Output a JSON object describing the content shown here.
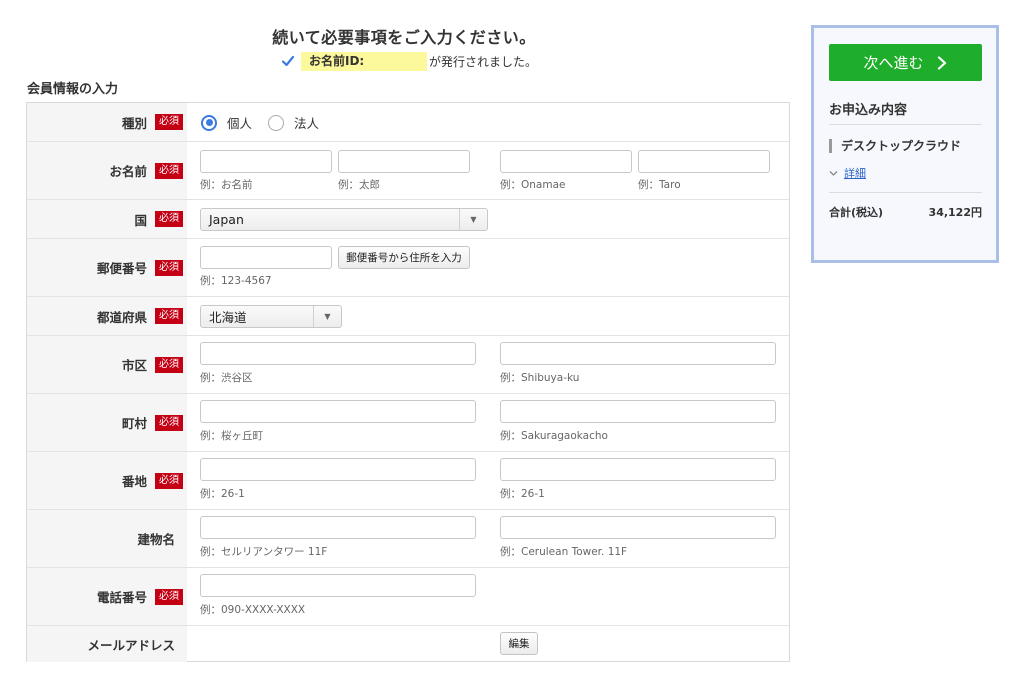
{
  "header": {
    "title": "続いて必要事項をご入力ください。",
    "id_label": "お名前ID:",
    "id_suffix": "が発行されました。"
  },
  "section_title": "会員情報の入力",
  "required_badge": "必須",
  "form": {
    "type": {
      "label": "種別",
      "options": [
        "個人",
        "法人"
      ],
      "selected": "個人"
    },
    "name": {
      "label": "お名前",
      "hints": [
        "例：お名前",
        "例：太郎",
        "例：Onamae",
        "例：Taro"
      ]
    },
    "country": {
      "label": "国",
      "value": "Japan"
    },
    "postal": {
      "label": "郵便番号",
      "button": "郵便番号から住所を入力",
      "hint": "例：123-4567"
    },
    "prefecture": {
      "label": "都道府県",
      "value": "北海道"
    },
    "city": {
      "label": "市区",
      "hints": [
        "例：渋谷区",
        "例：Shibuya-ku"
      ]
    },
    "town": {
      "label": "町村",
      "hints": [
        "例：桜ヶ丘町",
        "例：Sakuragaokacho"
      ]
    },
    "block": {
      "label": "番地",
      "hints": [
        "例：26-1",
        "例：26-1"
      ]
    },
    "building": {
      "label": "建物名",
      "hints": [
        "例：セルリアンタワー 11F",
        "例：Cerulean Tower. 11F"
      ]
    },
    "phone": {
      "label": "電話番号",
      "hint": "例：090-XXXX-XXXX"
    },
    "email": {
      "label": "メールアドレス",
      "button": "編集"
    }
  },
  "side_panel": {
    "next_button": "次へ進む",
    "title": "お申込み内容",
    "product": "デスクトップクラウド",
    "details_link": "詳細",
    "total_label": "合計(税込)",
    "total_value": "34,122円"
  },
  "colors": {
    "accent_green": "#1fae2b",
    "required_red": "#c40015",
    "highlight_yellow": "#fcf99c",
    "panel_border": "#a9bfe8",
    "link_blue": "#2a64c9"
  },
  "icons": {
    "check": "check-icon",
    "next": "chevron-right-icon",
    "select": "chevron-down-icon",
    "details": "chevron-down-icon"
  }
}
